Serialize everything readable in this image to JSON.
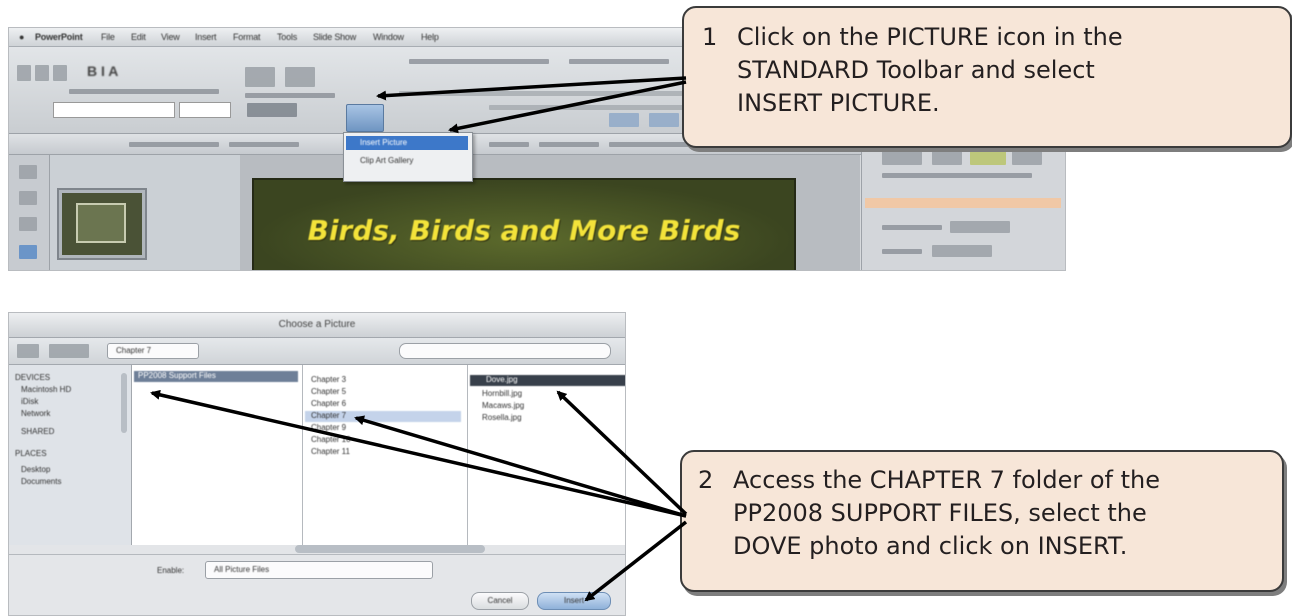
{
  "callout1": {
    "number": "1",
    "lines": [
      "Click on the PICTURE icon in the",
      "STANDARD Toolbar and select",
      "INSERT PICTURE."
    ]
  },
  "callout2": {
    "number": "2",
    "lines": [
      "Access the CHAPTER 7 folder of the",
      "PP2008 SUPPORT FILES, select the",
      "DOVE photo and click on INSERT."
    ]
  },
  "screenshot1": {
    "menu_items": [
      "PowerPoint",
      "File",
      "Edit",
      "View",
      "Insert",
      "Format",
      "Tools",
      "Slide Show",
      "Window",
      "Help"
    ],
    "picture_menu": {
      "selected_item": "Insert Picture",
      "other_item": "Clip Art Gallery"
    },
    "slide_title": "Birds, Birds and More Birds"
  },
  "screenshot2": {
    "dialog_title": "Choose a Picture",
    "path_popup": "Chapter 7",
    "sidebar_items": [
      "DEVICES",
      "Macintosh HD",
      "iDisk",
      "Network",
      "SHARED",
      "PLACES",
      "Desktop",
      "Documents"
    ],
    "column1_items": [
      "PP2008 Support Files"
    ],
    "column2_items": [
      "Chapter 3",
      "Chapter 5",
      "Chapter 6",
      "Chapter 7",
      "Chapter 9",
      "Chapter 10",
      "Chapter 11"
    ],
    "column3_items": [
      "Dove.jpg",
      "Hornbill.jpg",
      "Macaws.jpg",
      "Rosella.jpg"
    ],
    "enable_label": "Enable:",
    "enable_value": "All Picture Files",
    "cancel_label": "Cancel",
    "insert_label": "Insert"
  },
  "colors": {
    "callout_fill": "#f7e6d8",
    "callout_border": "#3b3b3b",
    "slide_title": "#f3e33a",
    "arrow": "#000000"
  }
}
